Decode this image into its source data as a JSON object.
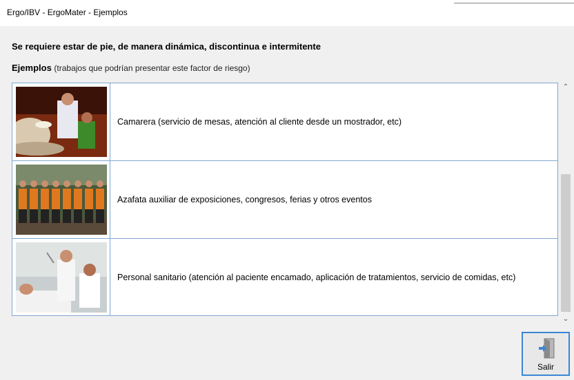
{
  "window": {
    "title": "Ergo/IBV - ErgoMater - Ejemplos"
  },
  "header": {
    "title": "Se requiere estar de pie, de manera dinámica, discontinua e intermitente",
    "examples_label": "Ejemplos",
    "examples_note": "(trabajos que podrían presentar este factor de riesgo)"
  },
  "examples": [
    {
      "label": "Camarera (servicio de mesas, atención al cliente desde un mostrador, etc)",
      "image": "waitress-photo"
    },
    {
      "label": "Azafata auxiliar de exposiciones, congresos, ferias y otros eventos",
      "image": "hostesses-photo"
    },
    {
      "label": "Personal sanitario (atención al paciente encamado, aplicación de tratamientos, servicio de comidas, etc)",
      "image": "healthcare-photo"
    }
  ],
  "scrollbar": {
    "up_icon": "chevron-up-icon",
    "down_icon": "chevron-down-icon"
  },
  "footer": {
    "exit_label": "Salir",
    "exit_icon": "door-exit-icon"
  }
}
